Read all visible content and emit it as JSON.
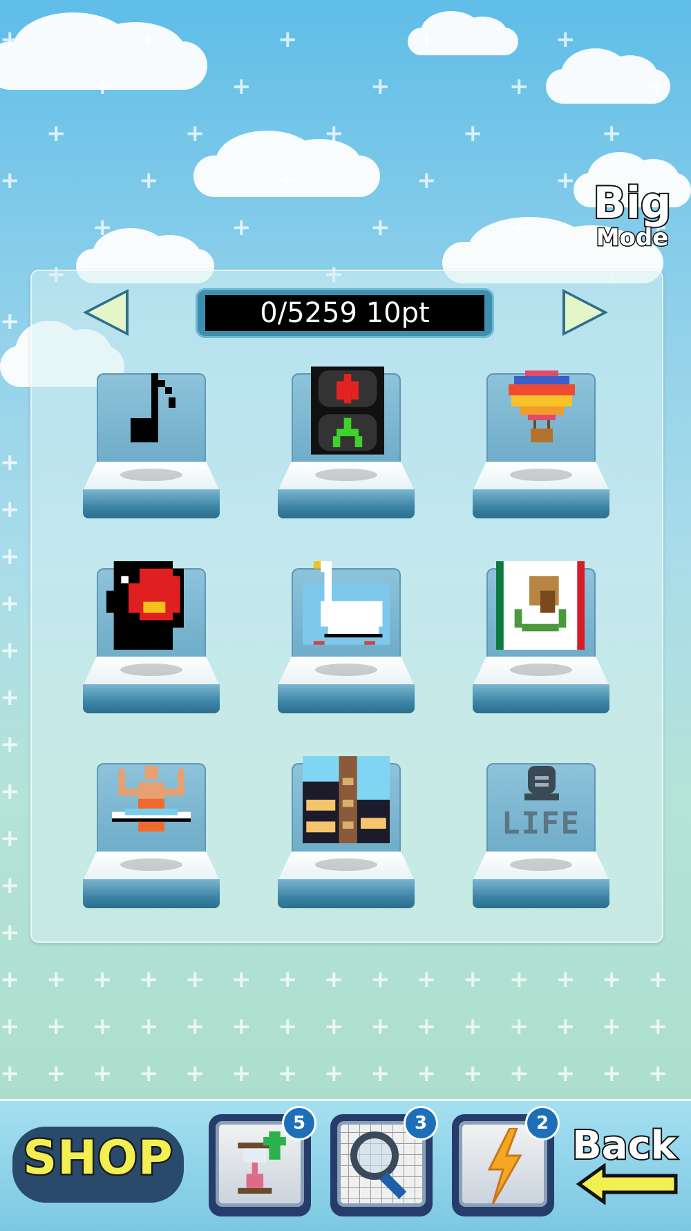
{
  "header": {
    "big_label": "Big",
    "mode_label": "Mode"
  },
  "panel": {
    "score_text": "0/5259 10pt"
  },
  "puzzles": [
    {
      "icon": "music-note-icon"
    },
    {
      "icon": "traffic-light-icon"
    },
    {
      "icon": "hot-air-balloon-icon"
    },
    {
      "icon": "red-bird-icon"
    },
    {
      "icon": "swan-icon"
    },
    {
      "icon": "mexico-flag-icon"
    },
    {
      "icon": "gymnast-icon"
    },
    {
      "icon": "building-icon"
    },
    {
      "icon": "tombstone-life-icon",
      "label": "LIFE"
    }
  ],
  "bottom_bar": {
    "shop_label": "SHOP",
    "items": [
      {
        "icon": "hourglass-up-icon",
        "count": "5"
      },
      {
        "icon": "magnifier-icon",
        "count": "3"
      },
      {
        "icon": "lightning-icon",
        "count": "2"
      }
    ],
    "back_label": "Back"
  },
  "colors": {
    "sky": "#5fbde8",
    "panel_accent": "#3d8fb0",
    "shop_text": "#f2ef53",
    "badge": "#1e6fb9"
  }
}
